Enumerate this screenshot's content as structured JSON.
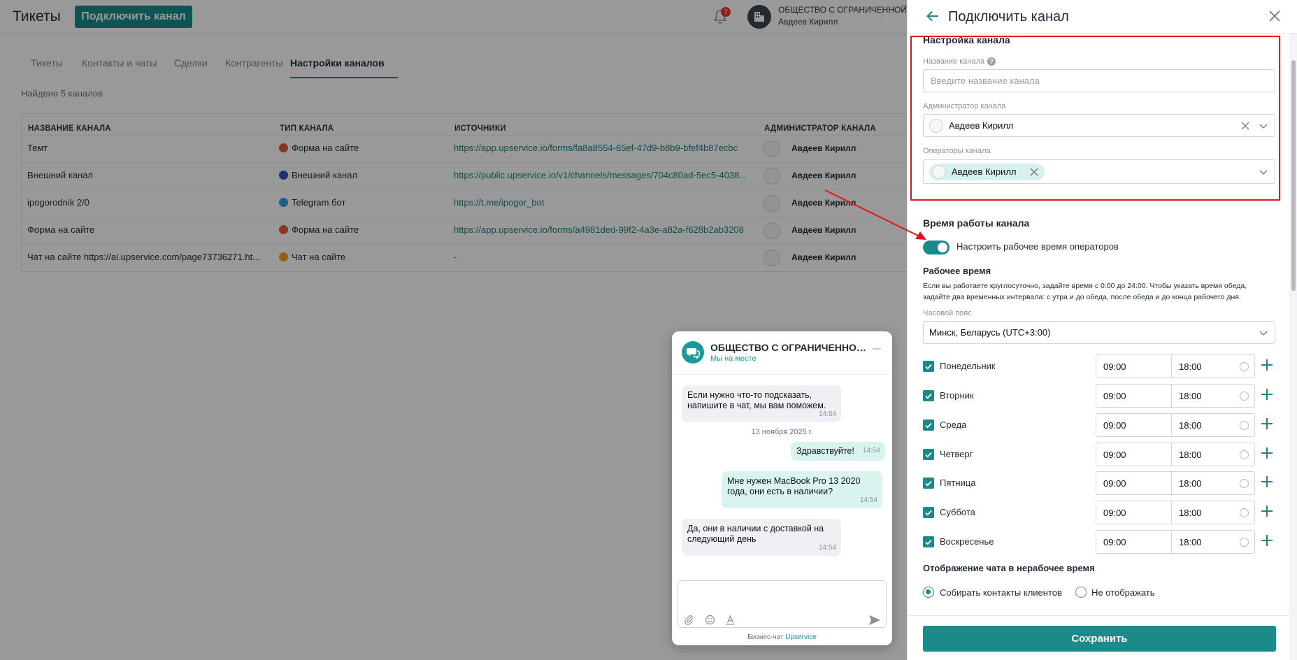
{
  "header": {
    "app_title": "Тикеты",
    "connect_button": "Подключить канал",
    "notifications_count": "7",
    "org_name": "ОБЩЕСТВО С ОГРАНИЧЕННОЙ ОТВ",
    "user_name": "Авдеев Кирилл"
  },
  "tabs": [
    {
      "label": "Тикеты"
    },
    {
      "label": "Контакты и чаты"
    },
    {
      "label": "Сделки"
    },
    {
      "label": "Контрагенты"
    },
    {
      "label": "Настройки каналов",
      "active": true
    }
  ],
  "found_text": "Найдено 5 каналов",
  "table": {
    "columns": [
      "НАЗВАНИЕ КАНАЛА",
      "ТИП КАНАЛА",
      "ИСТОЧНИКИ",
      "АДМИНИСТРАТОР КАНАЛА"
    ],
    "rows": [
      {
        "name": "Темт",
        "type": "Форма на сайте",
        "type_icon": "form-icon",
        "icon_color": "#e25c3c",
        "source": "https://app.upservice.io/forms/fa8a8554-65ef-47d9-b8b9-bfef4b87ecbc",
        "admin": "Авдеев Кирилл"
      },
      {
        "name": "Внешний канал",
        "type": "Внешний канал",
        "type_icon": "external-channel-icon",
        "icon_color": "#3b4dbf",
        "source": "https://public.upservice.io/v1/channels/messages/704c80ad-5ec5-4038...",
        "admin": "Авдеев Кирилл"
      },
      {
        "name": "ipogorodnik 2/0",
        "type": "Telegram бот",
        "type_icon": "telegram-icon",
        "icon_color": "#2aa3de",
        "source": "https://t.me/ipogor_bot",
        "admin": "Авдеев Кирилл"
      },
      {
        "name": "Форма на сайте",
        "type": "Форма на сайте",
        "type_icon": "form-icon",
        "icon_color": "#e25c3c",
        "source": "https://app.upservice.io/forms/a4981ded-99f2-4a3e-a82a-f628b2ab3208",
        "admin": "Авдеев Кирилл"
      },
      {
        "name": "Чат на сайте https://ai.upservice.com/page73736271.ht...",
        "type": "Чат на сайте",
        "type_icon": "site-chat-icon",
        "icon_color": "#f0a020",
        "source": "-",
        "admin": "Авдеев Кирилл"
      }
    ]
  },
  "chat": {
    "title": "ОБЩЕСТВО С ОГРАНИЧЕННОЙ О...",
    "status": "Мы на месте",
    "date": "13 ноября 2025 г.",
    "messages": [
      {
        "dir": "in",
        "line1": "Если нужно что-то подсказать,",
        "line2": "напишите в чат, мы вам поможем.",
        "time": "14:54"
      },
      {
        "dir": "out",
        "line1": "Здравствуйте!",
        "time": "14:54"
      },
      {
        "dir": "out",
        "line1": "Мне нужен MacBook Pro 13 2020",
        "line2": "года, они есть в наличии?",
        "time": "14:54"
      },
      {
        "dir": "in",
        "line1": "Да, они в наличии с доставкой на",
        "line2": "следующий день",
        "time": "14:54"
      }
    ],
    "footer_prefix": "Бизнес-чат",
    "footer_brand": "Upservice"
  },
  "panel": {
    "title": "Подключить канал",
    "settings_section": "Настройка канала",
    "name_label": "Название канала",
    "name_placeholder": "Введите название канала",
    "admin_label": "Администратор канала",
    "admin_value": "Авдеев Кирилл",
    "operators_label": "Операторы канала",
    "operator_chip": "Авдеев Кирилл",
    "work_section": "Время работы канала",
    "toggle_label": "Настроить рабочее время операторов",
    "toggle_on": true,
    "work_time_title": "Рабочее время",
    "hint_line1": "Если вы работаете круглосуточно, задайте время с 0:00 до 24:00. Чтобы указать время обеда,",
    "hint_line2": "задайте два временных интервала: с утра и до обеда, после обеда и до конца рабочего дня.",
    "timezone_label": "Часовой пояс",
    "timezone_value": "Минск, Беларусь (UTC+3:00)",
    "days": [
      {
        "label": "Понедельник",
        "from": "09:00",
        "to": "18:00",
        "checked": true
      },
      {
        "label": "Вторник",
        "from": "09:00",
        "to": "18:00",
        "checked": true
      },
      {
        "label": "Среда",
        "from": "09:00",
        "to": "18:00",
        "checked": true
      },
      {
        "label": "Четверг",
        "from": "09:00",
        "to": "18:00",
        "checked": true
      },
      {
        "label": "Пятница",
        "from": "09:00",
        "to": "18:00",
        "checked": true
      },
      {
        "label": "Суббота",
        "from": "09:00",
        "to": "18:00",
        "checked": true
      },
      {
        "label": "Воскресенье",
        "from": "09:00",
        "to": "18:00",
        "checked": true
      }
    ],
    "offhours_section": "Отображение чата в нерабочее время",
    "radio_collect": "Собирать контакты клиентов",
    "radio_hide": "Не отображать",
    "save_button": "Сохранить"
  },
  "colors": {
    "accent": "#1a8a8a",
    "highlight": "#e0181e"
  }
}
